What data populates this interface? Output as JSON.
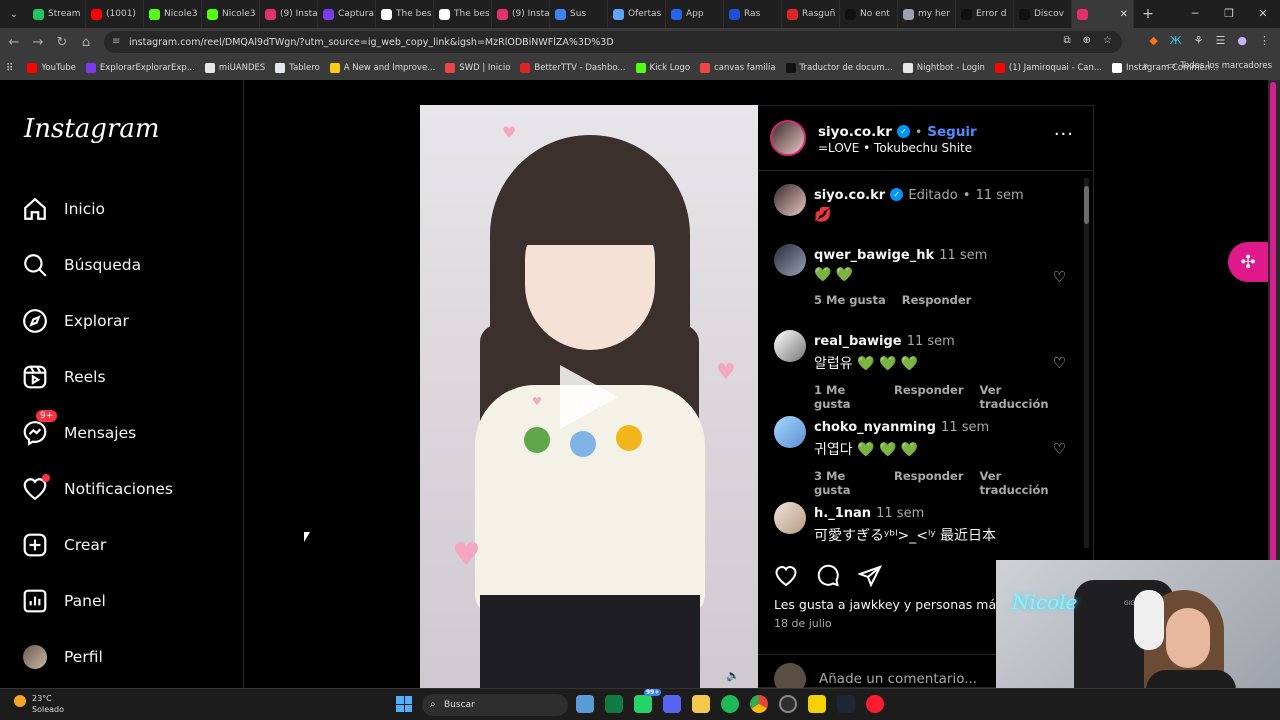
{
  "browser": {
    "tabs": [
      {
        "label": "Stream",
        "color": "#22c55e"
      },
      {
        "label": "(1001)",
        "color": "#ff0000"
      },
      {
        "label": "Nicole3",
        "color": "#53fc18"
      },
      {
        "label": "Nicole3",
        "color": "#53fc18"
      },
      {
        "label": "(9) Insta",
        "color": "#e1306c"
      },
      {
        "label": "Captura",
        "color": "#7c3aed"
      },
      {
        "label": "The bes",
        "color": "#ffffff"
      },
      {
        "label": "The bes",
        "color": "#ffffff"
      },
      {
        "label": "(9) Insta",
        "color": "#e1306c"
      },
      {
        "label": "Sus",
        "color": "#3b82f6"
      },
      {
        "label": "Ofertas",
        "color": "#60a5fa"
      },
      {
        "label": "App",
        "color": "#2563eb"
      },
      {
        "label": "Ras",
        "color": "#1d4ed8"
      },
      {
        "label": "Rasguñ",
        "color": "#dc2626"
      },
      {
        "label": "No ent",
        "color": "#111111"
      },
      {
        "label": "my her",
        "color": "#9ca3af"
      },
      {
        "label": "Error d",
        "color": "#111111"
      },
      {
        "label": "Discov",
        "color": "#111111"
      },
      {
        "label": "",
        "color": "#e1306c",
        "active": true
      }
    ],
    "new_tab_label": "+",
    "url": "instagram.com/reel/DMQAl9dTWgn/?utm_source=ig_web_copy_link&igsh=MzRlODBiNWFlZA%3D%3D",
    "bookmarks": [
      {
        "label": "YouTube",
        "color": "#ff0000"
      },
      {
        "label": "ExplorarExplorarExp...",
        "color": "#7c3aed"
      },
      {
        "label": "miUANDES",
        "color": "#e5e7eb"
      },
      {
        "label": "Tablero",
        "color": "#e5e7eb"
      },
      {
        "label": "A New and Improve...",
        "color": "#facc15"
      },
      {
        "label": "SWD | Inicio",
        "color": "#ef4444"
      },
      {
        "label": "BetterTTV - Dashbo...",
        "color": "#dc2626"
      },
      {
        "label": "Kick Logo",
        "color": "#53fc18"
      },
      {
        "label": "canvas familia",
        "color": "#ef4444"
      },
      {
        "label": "Traductor de docum...",
        "color": "#111111"
      },
      {
        "label": "Nightbot - Login",
        "color": "#e5e7eb"
      },
      {
        "label": "(1) Jamiroquai - Can...",
        "color": "#ff0000"
      },
      {
        "label": "Instagram Commen...",
        "color": "#ffffff"
      }
    ],
    "bookmarks_more": "»",
    "all_bookmarks": "Todos los marcadores"
  },
  "sidebar": {
    "logo": "Instagram",
    "items": [
      {
        "label": "Inicio",
        "icon": "home-icon"
      },
      {
        "label": "Búsqueda",
        "icon": "search-icon"
      },
      {
        "label": "Explorar",
        "icon": "compass-icon"
      },
      {
        "label": "Reels",
        "icon": "reels-icon"
      },
      {
        "label": "Mensajes",
        "icon": "messenger-icon",
        "badge": "9+"
      },
      {
        "label": "Notificaciones",
        "icon": "heart-icon"
      },
      {
        "label": "Crear",
        "icon": "plus-square-icon"
      },
      {
        "label": "Panel",
        "icon": "dashboard-icon"
      },
      {
        "label": "Perfil",
        "icon": "avatar"
      }
    ]
  },
  "post": {
    "username": "siyo.co.kr",
    "separator": "•",
    "follow_label": "Seguir",
    "audio": "=LOVE • Tokubechu Shite",
    "more": "···",
    "caption": {
      "username": "siyo.co.kr",
      "edited": "Editado",
      "dot": "•",
      "time": "11 sem",
      "text": "💋"
    },
    "comments": [
      {
        "username": "qwer_bawige_hk",
        "time": "11 sem",
        "text": "💚 💚",
        "likes": "5 Me gusta",
        "reply": "Responder",
        "translate": ""
      },
      {
        "username": "real_bawige",
        "time": "11 sem",
        "text": "알럽유 💚 💚 💚",
        "likes": "1 Me gusta",
        "reply": "Responder",
        "translate": "Ver traducción"
      },
      {
        "username": "choko_nyanming",
        "time": "11 sem",
        "text": "귀엽다 💚 💚 💚",
        "likes": "3 Me gusta",
        "reply": "Responder",
        "translate": "Ver traducción"
      },
      {
        "username": "h._1nan",
        "time": "11 sem",
        "text": "可愛すぎるʸᵇˡ>_<ˡʸ 最近日本",
        "likes": "",
        "reply": "",
        "translate": ""
      }
    ],
    "liked_by": "Les gusta a jawkkey y personas más",
    "date": "18 de julio",
    "add_comment": "Añade un comentario..."
  },
  "webcam": {
    "overlay_text": "Nicole"
  },
  "taskbar": {
    "temperature": "23°C",
    "condition": "Soleado",
    "weather_badge": "1",
    "search_placeholder": "Buscar",
    "whatsapp_badge": "99+"
  },
  "colors": {
    "instagram_blue": "#0095f6",
    "follow": "#4f8dff",
    "notification_red": "#ff3040",
    "widget_pink": "#e0198a"
  }
}
